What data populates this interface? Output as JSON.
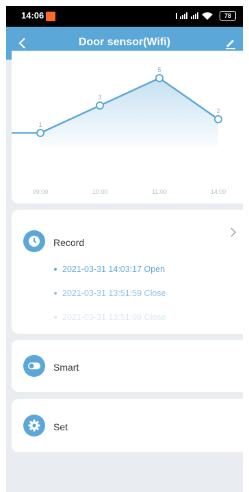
{
  "status_bar": {
    "time": "14:06",
    "battery": "78"
  },
  "app_bar": {
    "title": "Door sensor(Wifi)"
  },
  "chart_data": {
    "type": "line",
    "categories": [
      "09:00",
      "10:00",
      "11:00",
      "14:00"
    ],
    "values": [
      1,
      3,
      5,
      2
    ],
    "ylim": [
      0,
      6
    ],
    "color": "#5ba7d7"
  },
  "record": {
    "label": "Record",
    "items": [
      {
        "text": "2021-03-31 14:03:17 Open",
        "opacity": 1
      },
      {
        "text": "2021-03-31 13:51:59 Close",
        "opacity": 0.7
      },
      {
        "text": "2021-03-31 13:51:09 Close",
        "opacity": 0.25
      }
    ]
  },
  "smart": {
    "label": "Smart"
  },
  "set": {
    "label": "Set"
  },
  "colors": {
    "accent": "#5ba7d7",
    "background": "#e9ecf0"
  }
}
